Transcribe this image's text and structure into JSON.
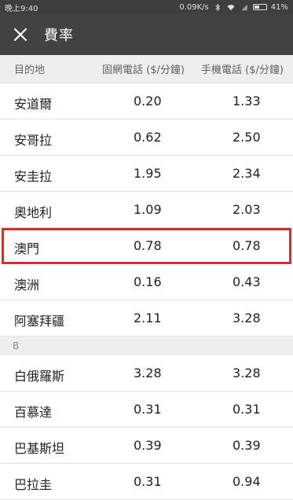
{
  "status_bar": {
    "time": "晚上9:40",
    "network_speed": "0.09K/s",
    "battery": "41%",
    "battery_level": 0.41,
    "icons": [
      "bluetooth-icon",
      "wifi-icon",
      "signal-icon",
      "battery-icon"
    ]
  },
  "app_bar": {
    "title": "費率",
    "close_icon": "close-icon"
  },
  "columns": {
    "destination": "目的地",
    "landline": "固網電話 ($/分鐘)",
    "mobile": "手機電話 ($/分鐘)"
  },
  "rows_a": [
    {
      "name": "安道爾",
      "landline": "0.20",
      "mobile": "1.33"
    },
    {
      "name": "安哥拉",
      "landline": "0.62",
      "mobile": "2.50"
    },
    {
      "name": "安圭拉",
      "landline": "1.95",
      "mobile": "2.34"
    },
    {
      "name": "奧地利",
      "landline": "1.09",
      "mobile": "2.03"
    },
    {
      "name": "澳門",
      "landline": "0.78",
      "mobile": "0.78"
    },
    {
      "name": "澳洲",
      "landline": "0.16",
      "mobile": "0.43"
    },
    {
      "name": "阿塞拜疆",
      "landline": "2.11",
      "mobile": "3.28"
    }
  ],
  "section_b": "B",
  "rows_b": [
    {
      "name": "白俄羅斯",
      "landline": "3.28",
      "mobile": "3.28"
    },
    {
      "name": "百慕達",
      "landline": "0.31",
      "mobile": "0.31"
    },
    {
      "name": "巴基斯坦",
      "landline": "0.39",
      "mobile": "0.39"
    },
    {
      "name": "巴拉圭",
      "landline": "0.31",
      "mobile": "0.94"
    }
  ],
  "colors": {
    "status_bar": "#3e3e3e",
    "app_bar": "#424242",
    "highlight": "#d32f2f",
    "header_bg": "#eeeeee"
  }
}
